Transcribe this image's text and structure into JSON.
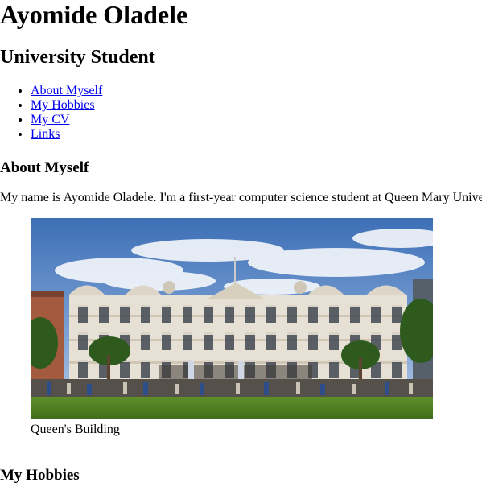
{
  "header": {
    "name": "Ayomide Oladele",
    "role": "University Student"
  },
  "nav": {
    "items": [
      {
        "label": "About Myself"
      },
      {
        "label": "My Hobbies"
      },
      {
        "label": "My CV"
      },
      {
        "label": "Links"
      }
    ]
  },
  "about": {
    "heading": "About Myself",
    "text": "My name is Ayomide Oladele. I'm a first-year computer science student at Queen Mary Unive",
    "figure": {
      "caption": "Queen's Building"
    }
  },
  "hobbies": {
    "heading": "My Hobbies"
  },
  "colors": {
    "link": "#0000ee",
    "text": "#000000"
  }
}
